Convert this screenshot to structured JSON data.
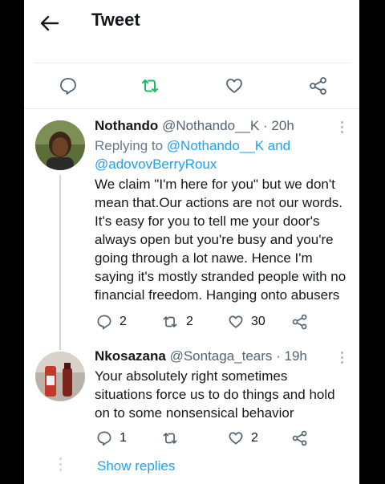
{
  "header": {
    "title": "Tweet",
    "back_icon": "arrow-left-icon"
  },
  "action_bar": {
    "icons": [
      "reply-icon",
      "retweet-icon",
      "like-icon",
      "share-icon"
    ],
    "retweet_color": "#17bf63"
  },
  "tweets": [
    {
      "author_name": "Nothando",
      "handle": "@Nothando__K",
      "time": "· 20h",
      "replying_prefix": "Replying to",
      "replying_to_1": "@Nothando__K",
      "replying_and": "and",
      "replying_to_2": "@adovovBerryRoux",
      "text_lines": [
        "We claim \"I'm here for you\" but we don't",
        "mean that.Our actions are not our words.",
        "It's easy for you to tell me your door's",
        "always open but you're busy and you're",
        "going through a lot nawe. Hence I'm",
        "saying it's mostly stranded people with no",
        "financial freedom. Hanging onto abusers"
      ],
      "replies": "2",
      "retweets": "2",
      "likes": "30"
    },
    {
      "author_name": "Nkosazana",
      "handle": "@Sontaga_tears",
      "time": "· 19h",
      "text_lines": [
        "Your absolutely right sometimes",
        "situations force us to do things and hold",
        "on to some nonsensical behavior"
      ],
      "replies": "1",
      "retweets": "",
      "likes": "2"
    }
  ],
  "show_replies": "Show replies",
  "colors": {
    "accent": "#1da1f2",
    "text": "#14171a",
    "secondary": "#657786"
  }
}
